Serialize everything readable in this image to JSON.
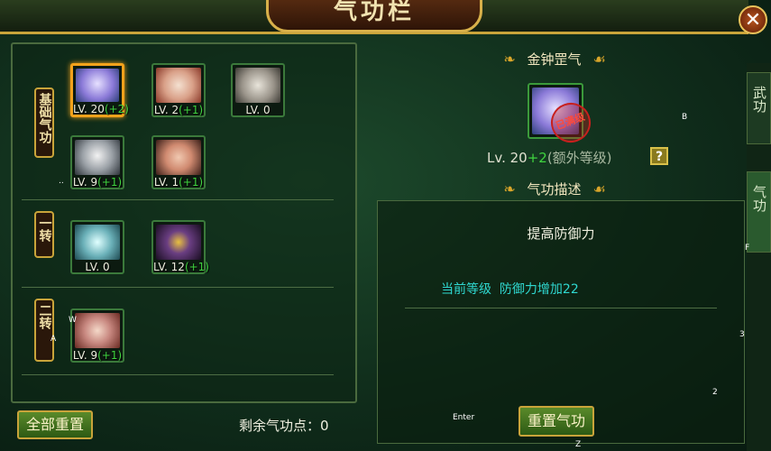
{
  "window": {
    "title": "气功栏",
    "close": "✕"
  },
  "side_tabs": [
    {
      "label": "武功"
    },
    {
      "label": "气功"
    }
  ],
  "rows": [
    {
      "label": "基础气功",
      "skills": [
        {
          "name": "金钟罡气",
          "level": "LV. 20",
          "bonus": "(+2)",
          "selected": true,
          "color": "#8b7ad8"
        },
        {
          "name": "skill-2",
          "level": "LV. 2",
          "bonus": "(+1)",
          "selected": false,
          "color": "#d9a088"
        },
        {
          "name": "skill-3",
          "level": "LV. 0",
          "bonus": "",
          "selected": false,
          "color": "#9a948a"
        },
        {
          "name": "skill-4",
          "level": "LV. 9",
          "bonus": "(+1)",
          "selected": false,
          "color": "#9aa0a6"
        },
        {
          "name": "skill-5",
          "level": "LV. 1",
          "bonus": "(+1)",
          "selected": false,
          "color": "#d08a70"
        }
      ]
    },
    {
      "label": "一转",
      "skills": [
        {
          "name": "skill-6",
          "level": "LV. 0",
          "bonus": "",
          "selected": false,
          "color": "#6ab0b8"
        },
        {
          "name": "skill-7",
          "level": "LV. 12",
          "bonus": "(+1)",
          "selected": false,
          "color": "#6a3e82"
        }
      ]
    },
    {
      "label": "二转",
      "skills": [
        {
          "name": "skill-8",
          "level": "LV. 9",
          "bonus": "(+1)",
          "selected": false,
          "color": "#c88880"
        }
      ]
    }
  ],
  "reset_all_label": "全部重置",
  "remaining_points": {
    "label": "剩余气功点：",
    "value": "0"
  },
  "detail": {
    "skill_name": "金钟罡气",
    "level_text": "Lv. 20",
    "level_bonus": "+2",
    "level_extra": "(额外等级)",
    "help": "?",
    "stamp": "已满级",
    "desc_header": "气功描述",
    "desc_title": "提高防御力",
    "current_label": "当前等级",
    "current_effect": "防御力增加22"
  },
  "reset_skill_label": "重置气功",
  "stray_labels": {
    "b": "B",
    "f": "F",
    "n3": "3",
    "n2": "2",
    "z": "Z",
    "enter": "Enter",
    "w": "W",
    "a": "A",
    "dots": ".."
  }
}
